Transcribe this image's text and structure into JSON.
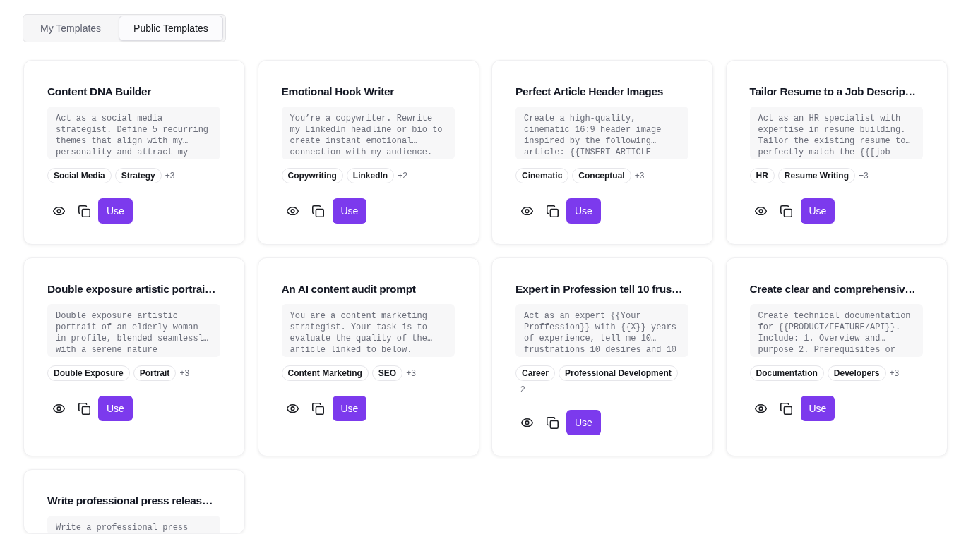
{
  "tabs": [
    {
      "label": "My Templates",
      "selected": false
    },
    {
      "label": "Public Templates",
      "selected": true
    }
  ],
  "templates": [
    {
      "title": "Content DNA Builder",
      "prompt": "Act as a social media strategist. Define 5 recurring themes that align with my… personality and attract my",
      "tags": [
        "Social Media",
        "Strategy"
      ],
      "more_tags": "+3",
      "use_button": "Use"
    },
    {
      "title": "Emotional Hook Writer",
      "prompt": "You’re a copywriter. Rewrite my LinkedIn headline or bio to create instant emotional… connection with my audience.",
      "tags": [
        "Copywriting",
        "LinkedIn"
      ],
      "more_tags": "+2",
      "use_button": "Use"
    },
    {
      "title": "Perfect Article Header Images",
      "prompt": "Create a high-quality, cinematic 16:9 header image inspired by the following… article: {{INSERT ARTICLE",
      "tags": [
        "Cinematic",
        "Conceptual"
      ],
      "more_tags": "+3",
      "use_button": "Use"
    },
    {
      "title": "Tailor Resume to a Job Descrip…",
      "prompt": "Act as an HR specialist with expertise in resume building. Tailor the existing resume to… perfectly match the {{[job",
      "tags": [
        "HR",
        "Resume Writing"
      ],
      "more_tags": "+3",
      "use_button": "Use"
    },
    {
      "title": "Double exposure artistic portrai…",
      "prompt": "Double exposure artistic portrait of an elderly woman in profile, blended seamlessl… with a serene nature",
      "tags": [
        "Double Exposure",
        "Portrait"
      ],
      "more_tags": "+3",
      "use_button": "Use"
    },
    {
      "title": "An AI content audit prompt",
      "prompt": "You are a content marketing strategist. Your task is to evaluate the quality of the… article linked to below.",
      "tags": [
        "Content Marketing",
        "SEO"
      ],
      "more_tags": "+3",
      "use_button": "Use"
    },
    {
      "title": "Expert in Profession tell 10 frus…",
      "prompt": "Act as an expert {{Your Proffession}} with {{X}} years of experience, tell me 10… frustrations 10 desires and 10",
      "tags": [
        "Career",
        "Professional Development"
      ],
      "more_tags": "+2",
      "use_button": "Use"
    },
    {
      "title": "Create clear and comprehensiv…",
      "prompt": "Create technical documentation for {{PRODUCT/FEATURE/API}}. Include: 1. Overview and… purpose 2. Prerequisites or",
      "tags": [
        "Documentation",
        "Developers"
      ],
      "more_tags": "+3",
      "use_button": "Use"
    },
    {
      "title": "Write professional press releas…",
      "prompt": "Write a professional press"
    }
  ]
}
